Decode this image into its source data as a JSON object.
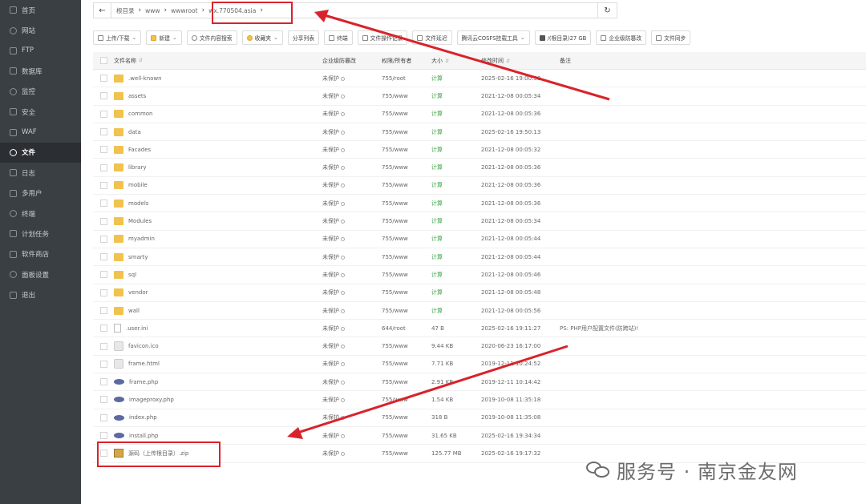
{
  "sidebar": {
    "items": [
      {
        "label": "首页",
        "icon": "home-icon"
      },
      {
        "label": "网站",
        "icon": "globe-icon"
      },
      {
        "label": "FTP",
        "icon": "ftp-icon"
      },
      {
        "label": "数据库",
        "icon": "database-icon"
      },
      {
        "label": "监控",
        "icon": "monitor-icon"
      },
      {
        "label": "安全",
        "icon": "shield-icon"
      },
      {
        "label": "WAF",
        "icon": "waf-icon"
      },
      {
        "label": "文件",
        "icon": "folder-icon",
        "active": true
      },
      {
        "label": "日志",
        "icon": "log-icon"
      },
      {
        "label": "多用户",
        "icon": "users-icon"
      },
      {
        "label": "终端",
        "icon": "terminal-icon"
      },
      {
        "label": "计划任务",
        "icon": "cron-icon"
      },
      {
        "label": "软件商店",
        "icon": "store-icon"
      },
      {
        "label": "面板设置",
        "icon": "settings-icon"
      },
      {
        "label": "退出",
        "icon": "logout-icon"
      }
    ]
  },
  "path": {
    "crumbs": [
      "根目录",
      "www",
      "wwwroot",
      "wx.770504.asia"
    ]
  },
  "toolbar": {
    "buttons": [
      "上传/下载",
      "新建",
      "文件内容搜索",
      "收藏夹",
      "分享列表",
      "终端",
      "文件操作记录",
      "文件延迟",
      "腾讯云COSFS挂载工具",
      "/(根目录)27 GB",
      "企业级防篡改",
      "文件同步"
    ]
  },
  "table": {
    "headers": {
      "name": "文件名称",
      "protect": "企业级防篡改",
      "perm": "权限/所有者",
      "size": "大小",
      "time": "修改时间",
      "note": "备注"
    },
    "rows": [
      {
        "name": ".well-known",
        "type": "folder",
        "prot": "未保护",
        "perm": "755/root",
        "size": "计算",
        "time": "2025-02-16 19:00:58",
        "note": ""
      },
      {
        "name": "assets",
        "type": "folder",
        "prot": "未保护",
        "perm": "755/www",
        "size": "计算",
        "time": "2021-12-08 00:05:34",
        "note": ""
      },
      {
        "name": "common",
        "type": "folder",
        "prot": "未保护",
        "perm": "755/www",
        "size": "计算",
        "time": "2021-12-08 00:05:36",
        "note": ""
      },
      {
        "name": "data",
        "type": "folder",
        "prot": "未保护",
        "perm": "755/www",
        "size": "计算",
        "time": "2025-02-16 19:50:13",
        "note": ""
      },
      {
        "name": "Facades",
        "type": "folder",
        "prot": "未保护",
        "perm": "755/www",
        "size": "计算",
        "time": "2021-12-08 00:05:32",
        "note": ""
      },
      {
        "name": "library",
        "type": "folder",
        "prot": "未保护",
        "perm": "755/www",
        "size": "计算",
        "time": "2021-12-08 00:05:36",
        "note": ""
      },
      {
        "name": "mobile",
        "type": "folder",
        "prot": "未保护",
        "perm": "755/www",
        "size": "计算",
        "time": "2021-12-08 00:05:36",
        "note": ""
      },
      {
        "name": "models",
        "type": "folder",
        "prot": "未保护",
        "perm": "755/www",
        "size": "计算",
        "time": "2021-12-08 00:05:36",
        "note": ""
      },
      {
        "name": "Modules",
        "type": "folder",
        "prot": "未保护",
        "perm": "755/www",
        "size": "计算",
        "time": "2021-12-08 00:05:34",
        "note": ""
      },
      {
        "name": "myadmin",
        "type": "folder",
        "prot": "未保护",
        "perm": "755/www",
        "size": "计算",
        "time": "2021-12-08 00:05:44",
        "note": ""
      },
      {
        "name": "smarty",
        "type": "folder",
        "prot": "未保护",
        "perm": "755/www",
        "size": "计算",
        "time": "2021-12-08 00:05:44",
        "note": ""
      },
      {
        "name": "sql",
        "type": "folder",
        "prot": "未保护",
        "perm": "755/www",
        "size": "计算",
        "time": "2021-12-08 00:05:46",
        "note": ""
      },
      {
        "name": "vendor",
        "type": "folder",
        "prot": "未保护",
        "perm": "755/www",
        "size": "计算",
        "time": "2021-12-08 00:05:48",
        "note": ""
      },
      {
        "name": "wall",
        "type": "folder",
        "prot": "未保护",
        "perm": "755/www",
        "size": "计算",
        "time": "2021-12-08 00:05:56",
        "note": ""
      },
      {
        "name": ".user.ini",
        "type": "file",
        "prot": "未保护",
        "perm": "644/root",
        "size": "47 B",
        "time": "2025-02-16 19:11:27",
        "note": "PS: PHP用户配置文件(防跨站)!"
      },
      {
        "name": "favicon.ico",
        "type": "img",
        "prot": "未保护",
        "perm": "755/www",
        "size": "9.44 KB",
        "time": "2020-06-23 16:17:00",
        "note": ""
      },
      {
        "name": "frame.html",
        "type": "img",
        "prot": "未保护",
        "perm": "755/www",
        "size": "7.71 KB",
        "time": "2019-12-11 10:24:52",
        "note": ""
      },
      {
        "name": "frame.php",
        "type": "php",
        "prot": "未保护",
        "perm": "755/www",
        "size": "2.91 KB",
        "time": "2019-12-11 10:14:42",
        "note": ""
      },
      {
        "name": "imageproxy.php",
        "type": "php",
        "prot": "未保护",
        "perm": "755/www",
        "size": "1.54 KB",
        "time": "2019-10-08 11:35:18",
        "note": ""
      },
      {
        "name": "index.php",
        "type": "php",
        "prot": "未保护",
        "perm": "755/www",
        "size": "318 B",
        "time": "2019-10-08 11:35:08",
        "note": ""
      },
      {
        "name": "install.php",
        "type": "php",
        "prot": "未保护",
        "perm": "755/www",
        "size": "31.65 KB",
        "time": "2025-02-16 19:34:34",
        "note": ""
      },
      {
        "name": "源码（上传根目录）.zip",
        "type": "zip",
        "prot": "未保护",
        "perm": "755/www",
        "size": "125.77 MB",
        "time": "2025-02-16 19:17:32",
        "note": ""
      }
    ]
  },
  "watermark": {
    "text": "服务号 · 南京金友网",
    "logo": "wechat-icon"
  },
  "colors": {
    "sidebar_bg": "#3a3f44",
    "annotation_red": "#d9232a",
    "folder_yellow": "#f0c24e",
    "size_green": "#3fa34a"
  }
}
